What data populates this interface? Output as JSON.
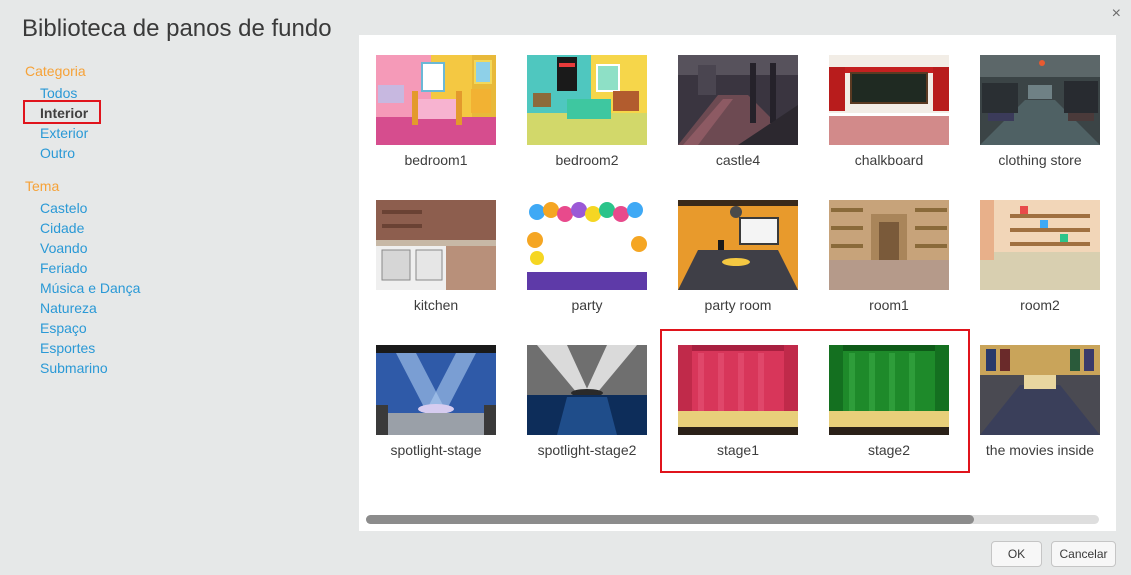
{
  "dialog": {
    "title": "Biblioteca de panos de fundo",
    "close_icon": "×"
  },
  "sidebar": {
    "category_heading": "Categoria",
    "categories": [
      "Todos",
      "Interior",
      "Exterior",
      "Outro"
    ],
    "selected_category": "Interior",
    "theme_heading": "Tema",
    "themes": [
      "Castelo",
      "Cidade",
      "Voando",
      "Feriado",
      "Música e Dança",
      "Natureza",
      "Espaço",
      "Esportes",
      "Submarino"
    ]
  },
  "backdrops": [
    {
      "label": "bedroom1"
    },
    {
      "label": "bedroom2"
    },
    {
      "label": "castle4"
    },
    {
      "label": "chalkboard"
    },
    {
      "label": "clothing store"
    },
    {
      "label": "kitchen"
    },
    {
      "label": "party"
    },
    {
      "label": "party room"
    },
    {
      "label": "room1"
    },
    {
      "label": "room2"
    },
    {
      "label": "spotlight-stage"
    },
    {
      "label": "spotlight-stage2"
    },
    {
      "label": "stage1"
    },
    {
      "label": "stage2"
    },
    {
      "label": "the movies inside"
    }
  ],
  "buttons": {
    "ok": "OK",
    "cancel": "Cancelar"
  },
  "colors": {
    "accent_orange": "#f6a238",
    "link_blue": "#2a99d6",
    "highlight_red": "#e0141c"
  }
}
